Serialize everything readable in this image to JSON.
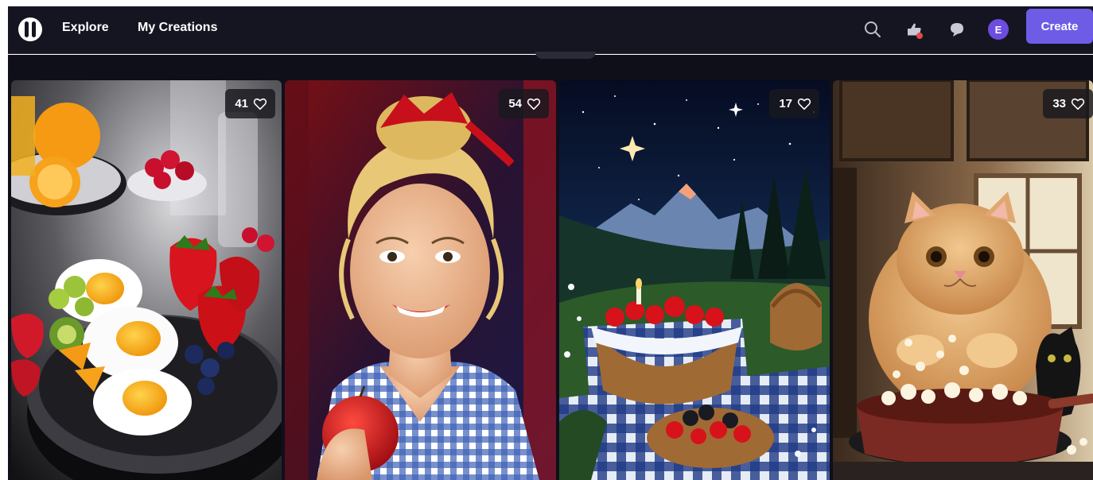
{
  "nav": {
    "explore": "Explore",
    "my_creations": "My Creations"
  },
  "header": {
    "avatar_initial": "E",
    "create_label": "Create"
  },
  "colors": {
    "topbar_bg": "#151522",
    "content_bg": "#0f0f1a",
    "accent": "#6e5ce6",
    "avatar_bg": "#6d4ce0",
    "notification_dot": "#e04a4a"
  },
  "gallery": {
    "cards": [
      {
        "subject": "breakfast-eggs-fruit",
        "likes": "41"
      },
      {
        "subject": "smiling-woman-apple",
        "likes": "54"
      },
      {
        "subject": "night-picnic-strawberries",
        "likes": "17"
      },
      {
        "subject": "cat-popcorn-kitchen",
        "likes": "33"
      }
    ]
  }
}
